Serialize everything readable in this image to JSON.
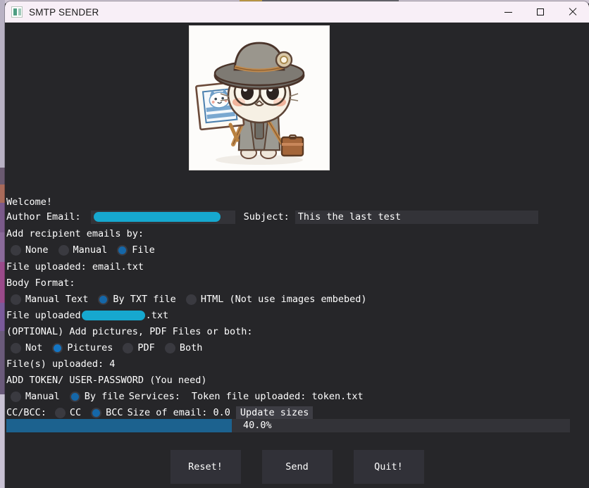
{
  "window": {
    "title": "SMTP SENDER",
    "icon": "app-icon",
    "controls": {
      "minimize": "minimize",
      "maximize": "maximize",
      "close": "close"
    }
  },
  "app": {
    "welcome": "Welcome!",
    "author_email": {
      "label": "Author Email:",
      "value": "",
      "redacted": true
    },
    "subject": {
      "label": "Subject:",
      "value": "This the last test"
    },
    "recipients": {
      "heading": "Add recipient emails by:",
      "options": [
        {
          "label": "None",
          "selected": false
        },
        {
          "label": "Manual",
          "selected": false
        },
        {
          "label": "File",
          "selected": true
        }
      ],
      "status": "File uploaded: email.txt"
    },
    "body_format": {
      "heading": "Body Format:",
      "options": [
        {
          "label": "Manual Text",
          "selected": false
        },
        {
          "label": "By TXT file",
          "selected": true
        },
        {
          "label": "HTML (Not use images embebed)",
          "selected": false
        }
      ],
      "status_prefix": "File uploaded",
      "status_suffix": ".txt",
      "status_redacted": true
    },
    "attachments": {
      "heading": "(OPTIONAL) Add pictures, PDF Files or both:",
      "options": [
        {
          "label": "Not",
          "selected": false
        },
        {
          "label": "Pictures",
          "selected": true
        },
        {
          "label": "PDF",
          "selected": false
        },
        {
          "label": "Both",
          "selected": false
        }
      ],
      "status": "File(s) uploaded: 4"
    },
    "token": {
      "heading": "ADD TOKEN/ USER-PASSWORD (You need)",
      "options": [
        {
          "label": "Manual",
          "selected": false
        },
        {
          "label": "By file",
          "selected": true
        }
      ],
      "services_label": "Services:",
      "status": "Token file uploaded: token.txt"
    },
    "ccbcc": {
      "label": "CC/BCC:",
      "options": [
        {
          "label": "CC",
          "selected": false
        },
        {
          "label": "BCC",
          "selected": true
        }
      ],
      "size_label": "Size of email: 0.0",
      "update_button": "Update sizes"
    },
    "progress": {
      "percent_text": "40.0%",
      "percent_value": 40
    },
    "actions": [
      {
        "label": "Reset!"
      },
      {
        "label": "Send"
      },
      {
        "label": "Quit!"
      }
    ]
  },
  "colors": {
    "accent_blue": "#1567a8",
    "redaction_cyan": "#16a8cf",
    "progress_fill": "#1c628f",
    "app_background": "#262629",
    "field_background": "#333338",
    "titlebar_background": "#f8eff7"
  }
}
